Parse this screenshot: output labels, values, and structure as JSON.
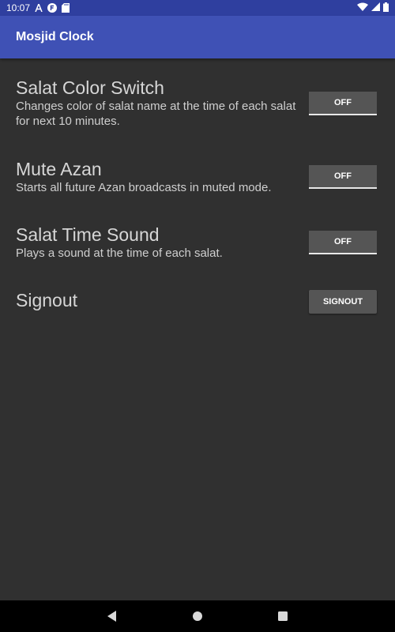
{
  "status_bar": {
    "time": "10:07",
    "icons_left": [
      "a-notification-icon",
      "app-notification-icon",
      "sd-card-icon"
    ],
    "icons_right": [
      "wifi-icon",
      "cellular-signal-icon",
      "battery-icon"
    ]
  },
  "app_bar": {
    "title": "Mosjid Clock",
    "color": "#3f51b5"
  },
  "settings": [
    {
      "title": "Salat Color Switch",
      "description": "Changes color of salat name at the time of each salat for next 10 minutes.",
      "button_label": "OFF"
    },
    {
      "title": "Mute Azan",
      "description": "Starts all future Azan broadcasts in muted mode.",
      "button_label": "OFF"
    },
    {
      "title": "Salat Time Sound",
      "description": "Plays a sound at the time of each salat.",
      "button_label": "OFF"
    },
    {
      "title": "Signout",
      "button_label": "SIGNOUT"
    }
  ],
  "nav_bar": {
    "buttons": [
      "back-icon",
      "home-icon",
      "recents-icon"
    ]
  },
  "colors": {
    "background": "#303030",
    "button": "#555555",
    "accent": "#3f51b5"
  }
}
